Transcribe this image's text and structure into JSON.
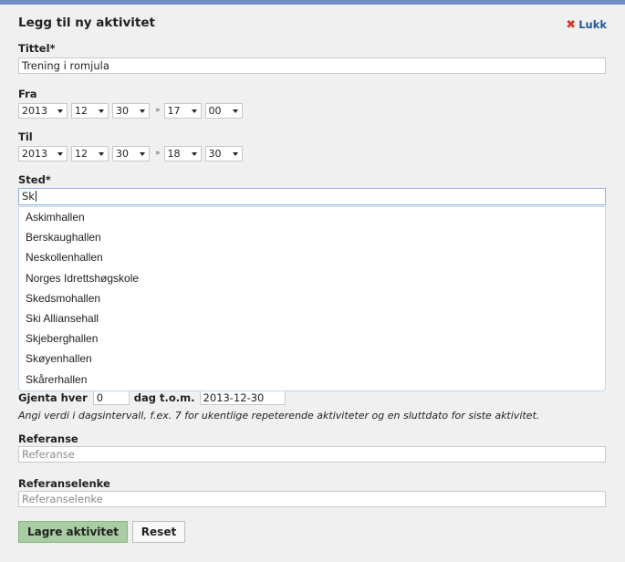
{
  "dialog": {
    "title": "Legg til ny aktivitet",
    "close_label": "Lukk",
    "close_icon": "x-icon"
  },
  "fields": {
    "tittel_label": "Tittel*",
    "tittel_value": "Trening i romjula",
    "fra_label": "Fra",
    "fra": {
      "year": "2013",
      "month": "12",
      "day": "30",
      "hour": "17",
      "minute": "00"
    },
    "til_label": "Til",
    "til": {
      "year": "2013",
      "month": "12",
      "day": "30",
      "hour": "18",
      "minute": "30"
    },
    "time_separator": "»",
    "sted_label": "Sted*",
    "sted_value": "Sk",
    "sted_suggestions": [
      "Askimhallen",
      "Berskaughallen",
      "Neskollenhallen",
      "Norges Idrettshøgskole",
      "Skedsmohallen",
      "Ski Alliansehall",
      "Skjeberghallen",
      "Skøyenhallen",
      "Skårerhallen"
    ],
    "gjenta_label": "Gjenta hver",
    "gjenta_value": "0",
    "dag_tom_label": "dag t.o.m.",
    "dag_tom_value": "2013-12-30",
    "gjenta_hint": "Angi verdi i dagsintervall, f.ex. 7 for ukentlige repeterende aktiviteter og en sluttdato for siste aktivitet.",
    "referanse_label": "Referanse",
    "referanse_placeholder": "Referanse",
    "referanselenke_label": "Referanselenke",
    "referanselenke_placeholder": "Referanselenke"
  },
  "buttons": {
    "save_label": "Lagre aktivitet",
    "reset_label": "Reset"
  },
  "colors": {
    "accent_bar": "#6f8fc4",
    "link": "#1d5a9a",
    "close_x": "#d23a2a",
    "primary_button": "#a8cda2"
  }
}
